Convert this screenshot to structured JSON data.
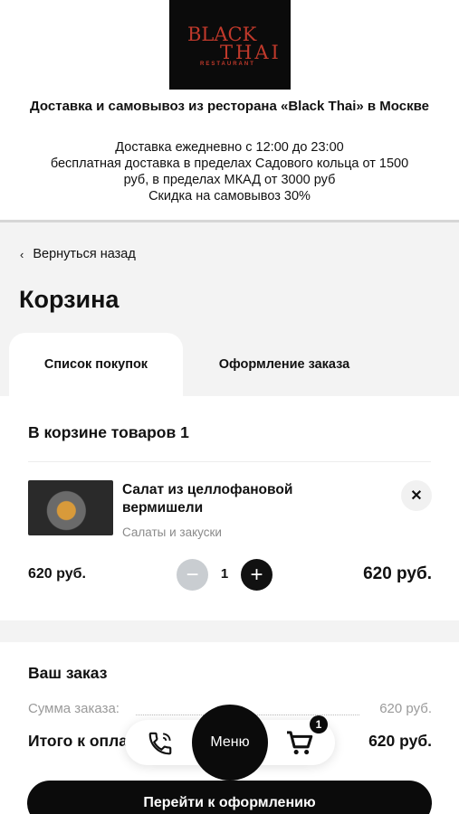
{
  "header": {
    "logo_line1": "BLACK",
    "logo_line2": "THAI",
    "logo_line3": "RESTAURANT",
    "title": "Доставка и самовывоз из ресторана «Black Thai» в Москве",
    "info_lines": [
      "Доставка ежедневно с 12:00 до 23:00",
      "бесплатная доставка в пределах Садового кольца от 1500",
      "руб, в пределах МКАД от 3000 руб",
      "Скидка на самовывоз 30%"
    ]
  },
  "nav": {
    "back_label": "Вернуться назад",
    "page_title": "Корзина",
    "tabs": [
      {
        "label": "Список покупок",
        "active": true
      },
      {
        "label": "Оформление заказа",
        "active": false
      }
    ]
  },
  "cart": {
    "count_label": "В корзине товаров 1",
    "item": {
      "name": "Салат из целлофановой вермишели",
      "category": "Салаты и закуски",
      "unit_price": "620 руб.",
      "quantity": "1",
      "line_total": "620 руб."
    }
  },
  "order": {
    "title": "Ваш заказ",
    "sum_label": "Сумма заказа:",
    "sum_value": "620 руб.",
    "pay_label": "Итого к оплате:",
    "pay_value": "620 руб.",
    "checkout_label": "Перейти к оформлению"
  },
  "bottom_bar": {
    "menu_label": "Меню",
    "cart_badge": "1",
    "icons": [
      "phone-icon",
      "cart-icon"
    ]
  },
  "colors": {
    "brand_red": "#c0392b",
    "dark": "#0b0b0b",
    "muted": "#8a8a8a"
  }
}
